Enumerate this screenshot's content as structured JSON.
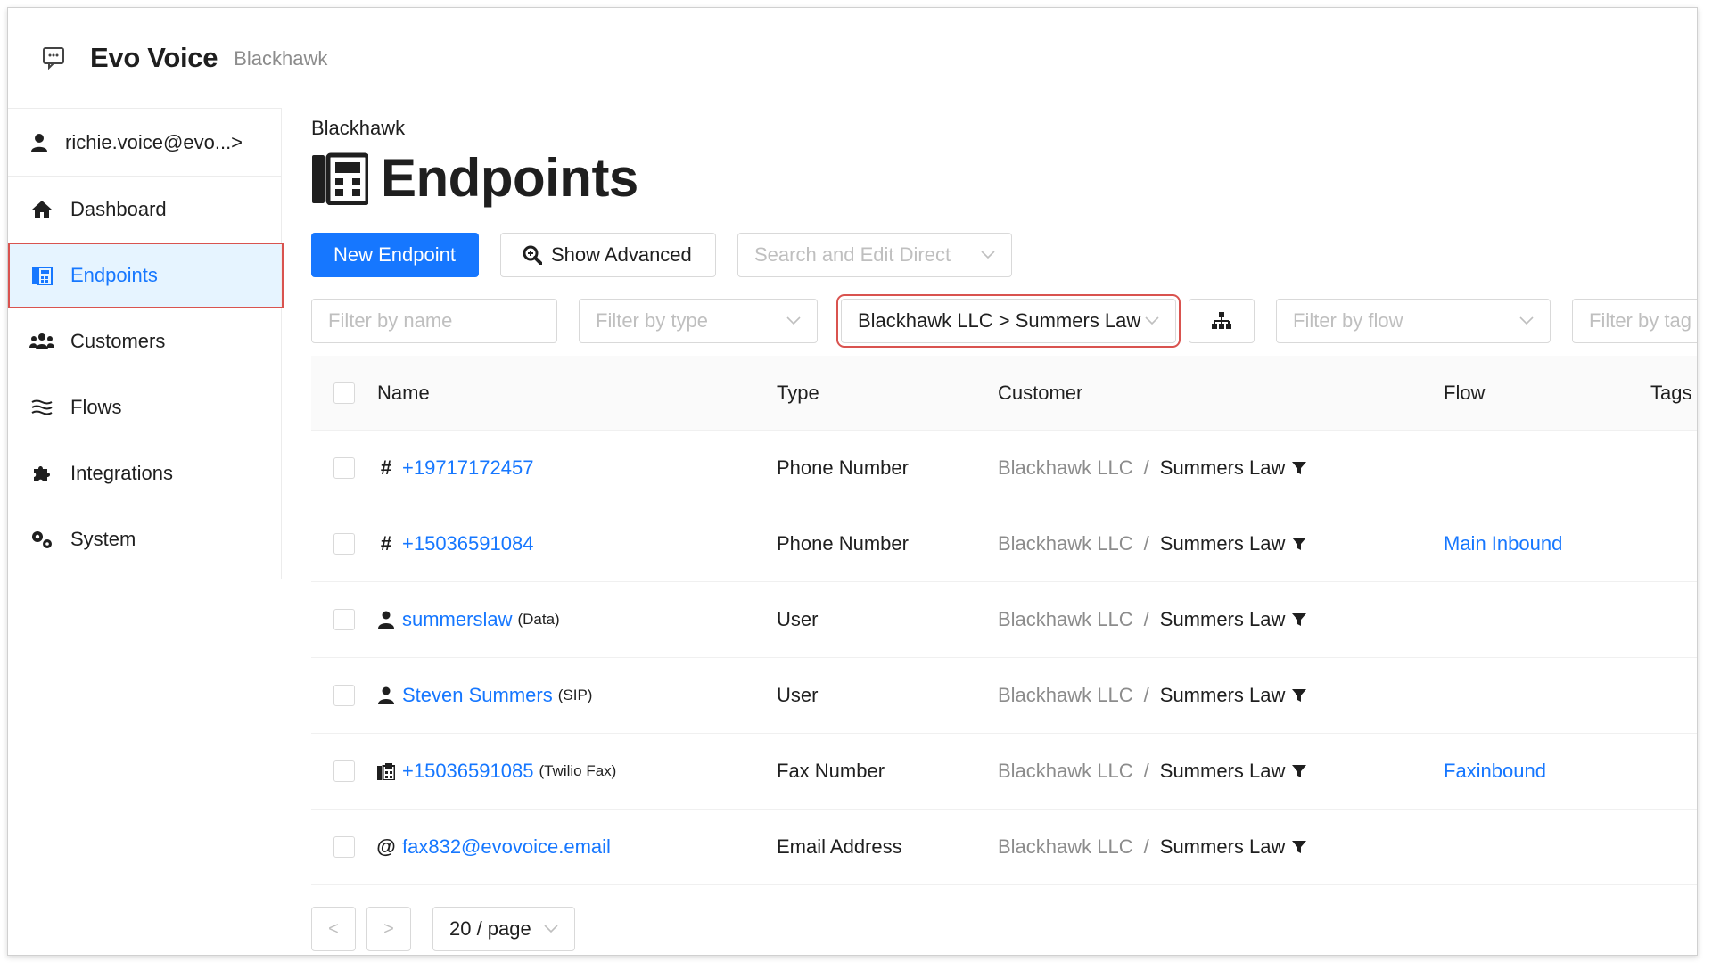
{
  "app": {
    "title": "Evo Voice",
    "subtitle": "Blackhawk"
  },
  "sidebar": {
    "user": "richie.voice@evo...>",
    "items": [
      {
        "label": "Dashboard",
        "icon": "home-icon"
      },
      {
        "label": "Endpoints",
        "icon": "endpoints-icon",
        "active": true
      },
      {
        "label": "Customers",
        "icon": "customers-icon"
      },
      {
        "label": "Flows",
        "icon": "flows-icon"
      },
      {
        "label": "Integrations",
        "icon": "puzzle-icon"
      },
      {
        "label": "System",
        "icon": "gears-icon"
      }
    ]
  },
  "main": {
    "breadcrumb": "Blackhawk",
    "title": "Endpoints",
    "toolbar": {
      "new_label": "New Endpoint",
      "advanced_label": "Show Advanced",
      "search_placeholder": "Search and Edit Direct"
    },
    "filters": {
      "name_placeholder": "Filter by name",
      "type_placeholder": "Filter by type",
      "customer_value": "Blackhawk LLC > Summers Law",
      "flow_placeholder": "Filter by flow",
      "tag_placeholder": "Filter by tag"
    },
    "table": {
      "columns": [
        "Name",
        "Type",
        "Customer",
        "Flow",
        "Tags"
      ],
      "rows": [
        {
          "icon": "#",
          "name": "+19717172457",
          "note": "",
          "type": "Phone Number",
          "customer_parent": "Blackhawk LLC",
          "customer_child": "Summers Law",
          "flow": ""
        },
        {
          "icon": "#",
          "name": "+15036591084",
          "note": "",
          "type": "Phone Number",
          "customer_parent": "Blackhawk LLC",
          "customer_child": "Summers Law",
          "flow": "Main Inbound"
        },
        {
          "icon": "user",
          "name": "summerslaw",
          "note": "(Data)",
          "type": "User",
          "customer_parent": "Blackhawk LLC",
          "customer_child": "Summers Law",
          "flow": ""
        },
        {
          "icon": "user",
          "name": "Steven Summers",
          "note": "(SIP)",
          "type": "User",
          "customer_parent": "Blackhawk LLC",
          "customer_child": "Summers Law",
          "flow": ""
        },
        {
          "icon": "fax",
          "name": "+15036591085",
          "note": "(Twilio Fax)",
          "type": "Fax Number",
          "customer_parent": "Blackhawk LLC",
          "customer_child": "Summers Law",
          "flow": "Faxinbound"
        },
        {
          "icon": "@",
          "name": "fax832@evovoice.email",
          "note": "",
          "type": "Email Address",
          "customer_parent": "Blackhawk LLC",
          "customer_child": "Summers Law",
          "flow": ""
        }
      ],
      "separator": "/"
    },
    "pagination": {
      "prev": "<",
      "next": ">",
      "page_size": "20 / page"
    }
  }
}
